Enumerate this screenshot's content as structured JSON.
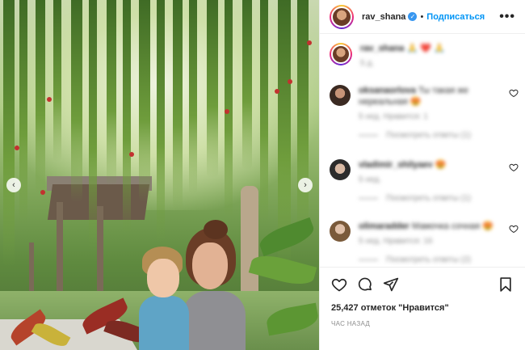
{
  "post": {
    "username": "rav_shana",
    "verified": true,
    "follow_label": "Подписаться",
    "separator": "•",
    "more_label": "•••"
  },
  "caption": {
    "username": "rav_shana",
    "text": "🙏 ❤️ 🙏",
    "meta": "5 д."
  },
  "comments": [
    {
      "username": "oksanaorlova",
      "text": "Ты такая же нереальная 😍",
      "meta": "5 нед.   Нравится: 1",
      "replies": "Посмотреть ответы (1)"
    },
    {
      "username": "vladimir_shilyaev",
      "text": "😍",
      "meta": "5 нед.",
      "replies": "Посмотреть ответы (1)"
    },
    {
      "username": "olimaradder",
      "text": "Мамочка сочная 😍",
      "meta": "5 нед.   Нравится: 16",
      "replies": "Посмотреть ответы (2)"
    }
  ],
  "actions": {
    "like": "heart-icon",
    "comment": "comment-icon",
    "share": "share-icon",
    "save": "bookmark-icon"
  },
  "likes_label": "25,427 отметок \"Нравится\"",
  "timestamp": "ЧАС НАЗАД",
  "carousel": {
    "prev": "‹",
    "next": "›"
  },
  "colors": {
    "accent": "#0095f6",
    "verified": "#3897f0",
    "text": "#262626",
    "muted": "#8e8e8e"
  }
}
